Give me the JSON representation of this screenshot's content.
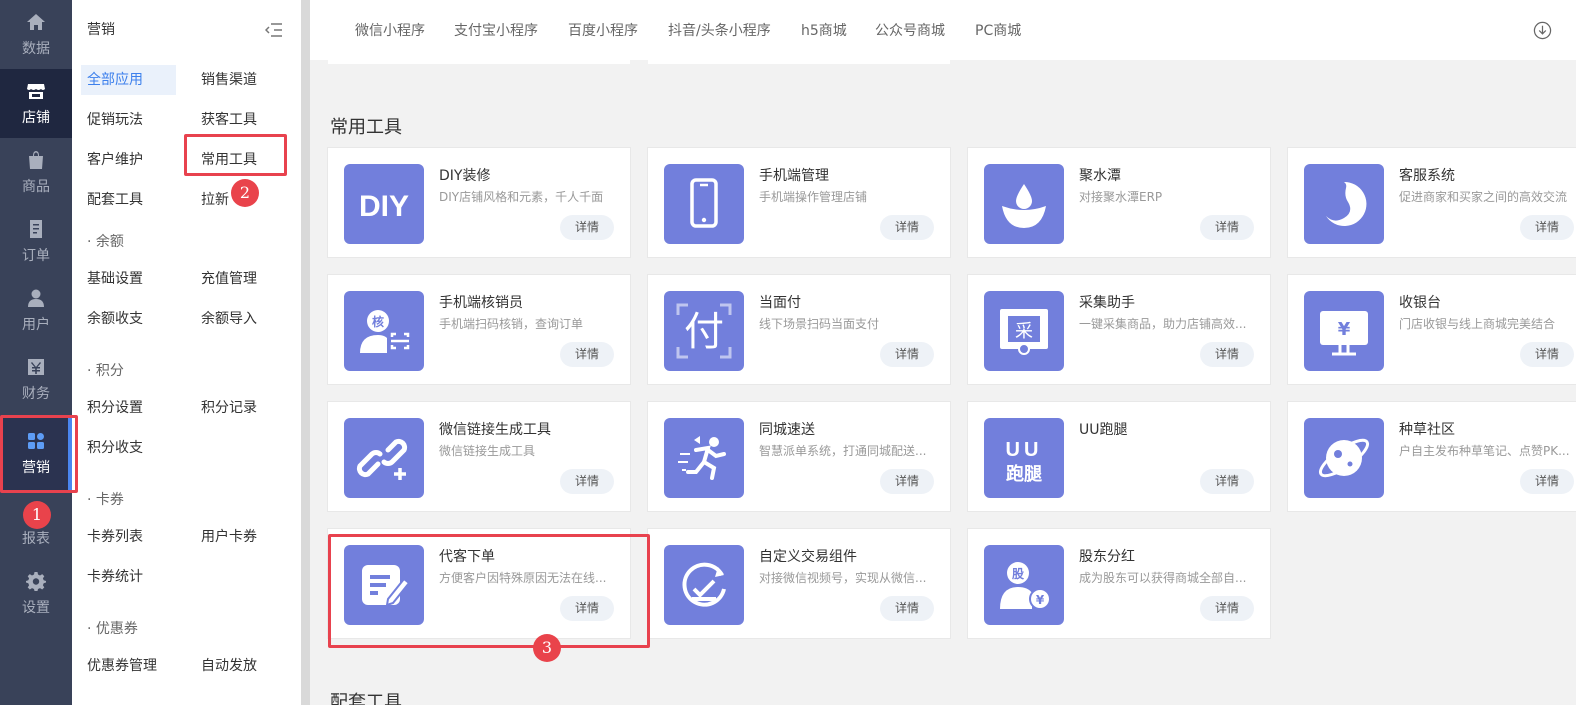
{
  "rail": {
    "items": [
      {
        "label": "数据",
        "icon": "home-icon"
      },
      {
        "label": "店铺",
        "icon": "store-icon"
      },
      {
        "label": "商品",
        "icon": "bag-icon"
      },
      {
        "label": "订单",
        "icon": "order-icon"
      },
      {
        "label": "用户",
        "icon": "user-icon"
      },
      {
        "label": "财务",
        "icon": "finance-icon"
      },
      {
        "label": "营销",
        "icon": "grid-icon"
      },
      {
        "label": "报表",
        "icon": "report-icon"
      },
      {
        "label": "设置",
        "icon": "gear-icon"
      }
    ]
  },
  "submenu": {
    "title": "营销",
    "items": {
      "all_apps": "全部应用",
      "sales_channel": "销售渠道",
      "promo": "促销玩法",
      "acquire": "获客工具",
      "customer": "客户维护",
      "common_tools": "常用工具",
      "supporting": "配套工具",
      "new_pull": "拉新",
      "balance_group": "· 余额",
      "basic_settings": "基础设置",
      "recharge_mgmt": "充值管理",
      "balance_flow": "余额收支",
      "balance_import": "余额导入",
      "points_group": "· 积分",
      "points_settings": "积分设置",
      "points_record": "积分记录",
      "points_flow": "积分收支",
      "coupon_card_group": "· 卡券",
      "card_list": "卡券列表",
      "user_cards": "用户卡券",
      "card_stats": "卡券统计",
      "discount_group": "· 优惠券",
      "coupon_mgmt": "优惠券管理",
      "auto_send": "自动发放"
    }
  },
  "tabs": [
    "微信小程序",
    "支付宝小程序",
    "百度小程序",
    "抖音/头条小程序",
    "h5商城",
    "公众号商城",
    "PC商城"
  ],
  "sections": {
    "common_tools": "常用工具",
    "supporting_tools": "配套工具"
  },
  "detail_label": "详情",
  "cards": [
    {
      "title": "DIY装修",
      "desc": "DIY店铺风格和元素，千人千面",
      "icon": "diy-icon"
    },
    {
      "title": "手机端管理",
      "desc": "手机端操作管理店铺",
      "icon": "phone-icon"
    },
    {
      "title": "聚水潭",
      "desc": "对接聚水潭ERP",
      "icon": "water-drop-icon"
    },
    {
      "title": "客服系统",
      "desc": "促进商家和买家之间的高效交流",
      "icon": "customer-service-icon"
    },
    {
      "title": "手机端核销员",
      "desc": "手机端扫码核销，查询订单",
      "icon": "verify-staff-icon"
    },
    {
      "title": "当面付",
      "desc": "线下场景扫码当面支付",
      "icon": "face-pay-icon"
    },
    {
      "title": "采集助手",
      "desc": "一键采集商品，助力店铺高效...",
      "icon": "collect-icon"
    },
    {
      "title": "收银台",
      "desc": "门店收银与线上商城完美结合",
      "icon": "cashier-icon"
    },
    {
      "title": "微信链接生成工具",
      "desc": "微信链接生成工具",
      "icon": "link-icon"
    },
    {
      "title": "同城速送",
      "desc": "智慧派单系统，打通同城配送...",
      "icon": "runner-icon"
    },
    {
      "title": "UU跑腿",
      "desc": "",
      "icon": "uu-icon"
    },
    {
      "title": "种草社区",
      "desc": "户自主发布种草笔记、点赞PK...",
      "icon": "planet-icon"
    },
    {
      "title": "代客下单",
      "desc": "方便客户因特殊原因无法在线...",
      "icon": "edit-note-icon"
    },
    {
      "title": "自定义交易组件",
      "desc": "对接微信视频号，实现从微信...",
      "icon": "trade-component-icon"
    },
    {
      "title": "股东分红",
      "desc": "成为股东可以获得商城全部自...",
      "icon": "shareholder-icon"
    }
  ],
  "icon_glyphs": {
    "diy": "DIY",
    "face_pay": "付",
    "verify": "核",
    "collect": "采",
    "yen": "¥",
    "uu_top": "UU",
    "uu_bottom": "跑腿",
    "shareholder": "股"
  },
  "badges": [
    "1",
    "2",
    "3"
  ],
  "colors": {
    "rail_bg": "#394259",
    "icon_bg": "#727fdc",
    "accent": "#3d80ec",
    "highlight": "#e8424e"
  }
}
